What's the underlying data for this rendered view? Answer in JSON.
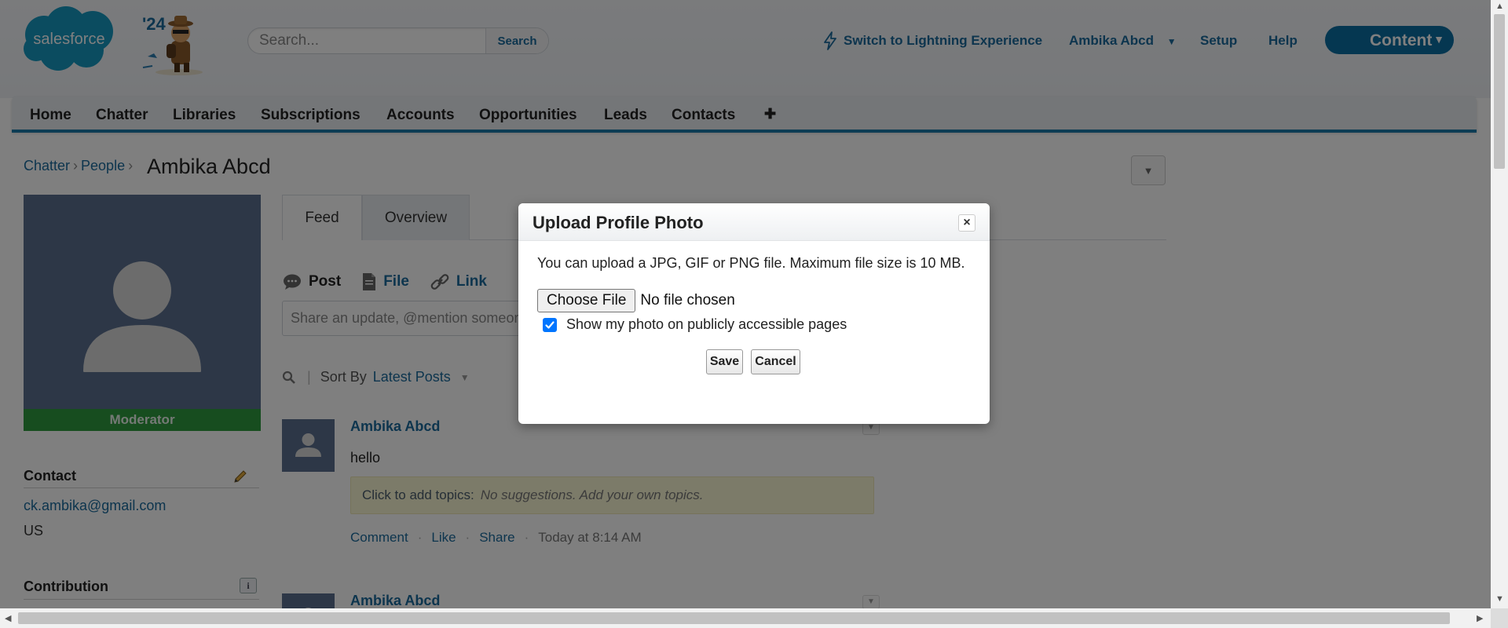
{
  "header": {
    "logo_text": "salesforce",
    "badge_text": "'24",
    "search_placeholder": "Search...",
    "search_button": "Search",
    "switch_lightning": "Switch to Lightning Experience",
    "user_menu": "Ambika Abcd",
    "setup": "Setup",
    "help": "Help",
    "content_button": "Content"
  },
  "nav": {
    "items": [
      "Home",
      "Chatter",
      "Libraries",
      "Subscriptions",
      "Accounts",
      "Opportunities",
      "Leads",
      "Contacts"
    ],
    "plus": "✚"
  },
  "breadcrumb": {
    "chatter": "Chatter",
    "people": "People",
    "sep": "›"
  },
  "page_title": "Ambika Abcd",
  "sidebar": {
    "moderator": "Moderator",
    "contact_heading": "Contact",
    "email": "ck.ambika@gmail.com",
    "country": "US",
    "contribution_heading": "Contribution",
    "info_glyph": "i"
  },
  "tabs": [
    "Feed",
    "Overview"
  ],
  "publisher": {
    "post": "Post",
    "file": "File",
    "link": "Link",
    "share_placeholder": "Share an update, @mention someone"
  },
  "sort": {
    "label": "Sort By",
    "value": "Latest Posts"
  },
  "posts": [
    {
      "author": "Ambika Abcd",
      "text": "hello",
      "topics_label": "Click to add topics:",
      "topics_hint": "No suggestions. Add your own topics.",
      "actions": [
        "Comment",
        "Like",
        "Share"
      ],
      "time": "Today at 8:14 AM"
    },
    {
      "author": "Ambika Abcd"
    }
  ],
  "modal": {
    "title": "Upload Profile Photo",
    "close": "×",
    "description": "You can upload a JPG, GIF or PNG file. Maximum file size is 10 MB.",
    "choose_file": "Choose File",
    "no_file": "No file chosen",
    "public_checkbox_label": "Show my photo on publicly accessible pages",
    "public_checkbox_checked": true,
    "save": "Save",
    "cancel": "Cancel"
  },
  "colors": {
    "brand_blue": "#1b6a9c",
    "content_button": "#0a6ea3",
    "moderator_green": "#2f9a3e",
    "avatar_bg": "#5a6f8e"
  }
}
